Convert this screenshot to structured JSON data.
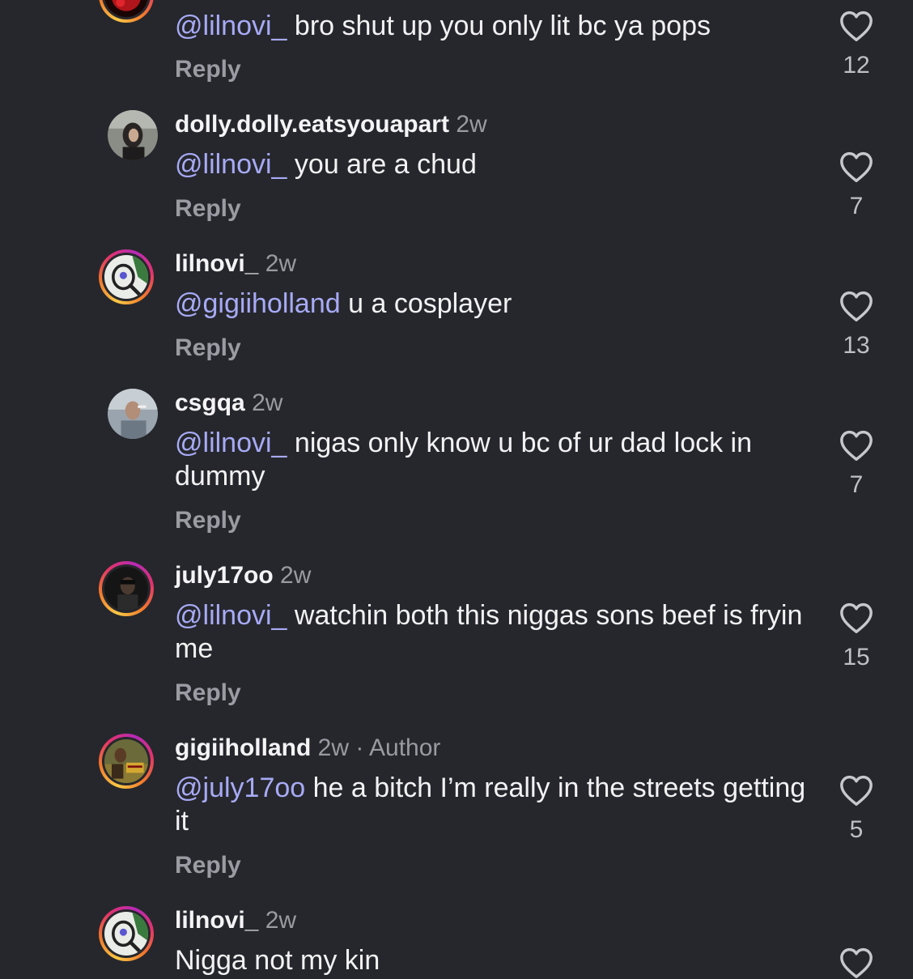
{
  "comments": [
    {
      "username": "",
      "time": "",
      "author_tag": "",
      "mention": "@lilnovi_",
      "text": " bro shut up you only lit bc ya pops",
      "reply_label": "Reply",
      "likes": "12"
    },
    {
      "username": "dolly.dolly.eatsyouapart",
      "time": "2w",
      "author_tag": "",
      "mention": "@lilnovi_",
      "text": " you are a chud",
      "reply_label": "Reply",
      "likes": "7"
    },
    {
      "username": "lilnovi_",
      "time": "2w",
      "author_tag": "",
      "mention": "@gigiiholland",
      "text": " u a cosplayer",
      "reply_label": "Reply",
      "likes": "13"
    },
    {
      "username": "csgqa",
      "time": "2w",
      "author_tag": "",
      "mention": "@lilnovi_",
      "text": " nigas only know u bc of ur dad lock in dummy",
      "reply_label": "Reply",
      "likes": "7"
    },
    {
      "username": "july17oo",
      "time": "2w",
      "author_tag": "",
      "mention": "@lilnovi_",
      "text": " watchin both this niggas sons beef is fryin me",
      "reply_label": "Reply",
      "likes": "15"
    },
    {
      "username": "gigiiholland",
      "time": "2w",
      "author_tag": " · Author",
      "mention": "@july17oo",
      "text": " he a bitch I’m really in the streets getting it",
      "reply_label": "Reply",
      "likes": "5"
    },
    {
      "username": "lilnovi_",
      "time": "2w",
      "author_tag": "",
      "mention": "",
      "text": "Nigga not my kin",
      "reply_label": "",
      "likes": ""
    }
  ],
  "colors": {
    "background": "#26272c",
    "mention": "#a7aaf5",
    "meta": "#9a9aa2",
    "story_ring": [
      "#f9c846",
      "#f27a2c",
      "#e2336b",
      "#b52ab7"
    ]
  },
  "icons": {
    "like": "heart-outline-icon"
  }
}
